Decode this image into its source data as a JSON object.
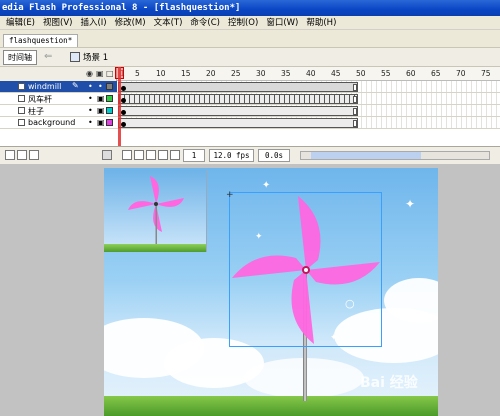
{
  "window": {
    "title": "edia Flash Professional 8 - [flashquestion*]"
  },
  "menubar": {
    "items": [
      "编辑(E)",
      "视图(V)",
      "插入(I)",
      "修改(M)",
      "文本(T)",
      "命令(C)",
      "控制(O)",
      "窗口(W)",
      "帮助(H)"
    ]
  },
  "document": {
    "tab_label": "flashquestion*"
  },
  "timeline_toolbar": {
    "timeline_label": "时间轴",
    "scene_label": "场景 1"
  },
  "frame_ruler": {
    "ticks": [
      "1",
      "5",
      "10",
      "15",
      "20",
      "25",
      "30",
      "35",
      "40",
      "45",
      "50",
      "55",
      "60",
      "65",
      "70",
      "75"
    ]
  },
  "layers": [
    {
      "name": "windmill",
      "selected": true,
      "color": "#808080"
    },
    {
      "name": "风车杆",
      "selected": false,
      "color": "#2ecc40"
    },
    {
      "name": "柱子",
      "selected": false,
      "color": "#00cccc"
    },
    {
      "name": "background",
      "selected": false,
      "color": "#e040e0"
    }
  ],
  "timeline_status": {
    "current_frame": "1",
    "frame_rate": "12.0 fps",
    "elapsed_time": "0.0s"
  },
  "stage": {
    "watermark": "Bai 经验",
    "pinwheel_color": "#ff66e0"
  }
}
